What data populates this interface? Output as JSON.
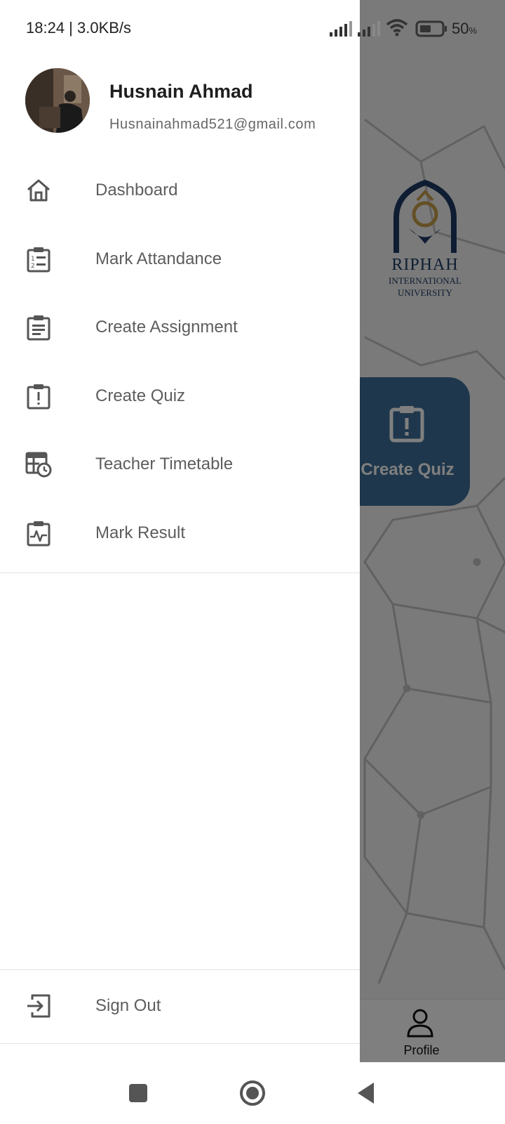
{
  "status_bar": {
    "time_speed": "18:24 | 3.0KB/s",
    "battery_value": "50",
    "battery_unit": "%"
  },
  "background": {
    "logo_line1": "RIPHAH",
    "logo_line2": "INTERNATIONAL",
    "logo_line3": "UNIVERSITY",
    "card_label": "Create Quiz",
    "bottom_nav_label": "Profile"
  },
  "drawer": {
    "user_name": "Husnain Ahmad",
    "user_email": "Husnainahmad521@gmail.com",
    "items": [
      {
        "label": "Dashboard",
        "icon": "home-icon"
      },
      {
        "label": "Mark Attandance",
        "icon": "numbered-list-clipboard-icon"
      },
      {
        "label": "Create Assignment",
        "icon": "assignment-clipboard-icon"
      },
      {
        "label": "Create Quiz",
        "icon": "quiz-clipboard-icon"
      },
      {
        "label": "Teacher Timetable",
        "icon": "timetable-clock-icon"
      },
      {
        "label": "Mark Result",
        "icon": "result-chart-clipboard-icon"
      }
    ],
    "sign_out_label": "Sign Out"
  },
  "colors": {
    "card_accent": "#3e6f99",
    "logo_navy": "#1f3b66",
    "icon_gray": "#555555"
  }
}
